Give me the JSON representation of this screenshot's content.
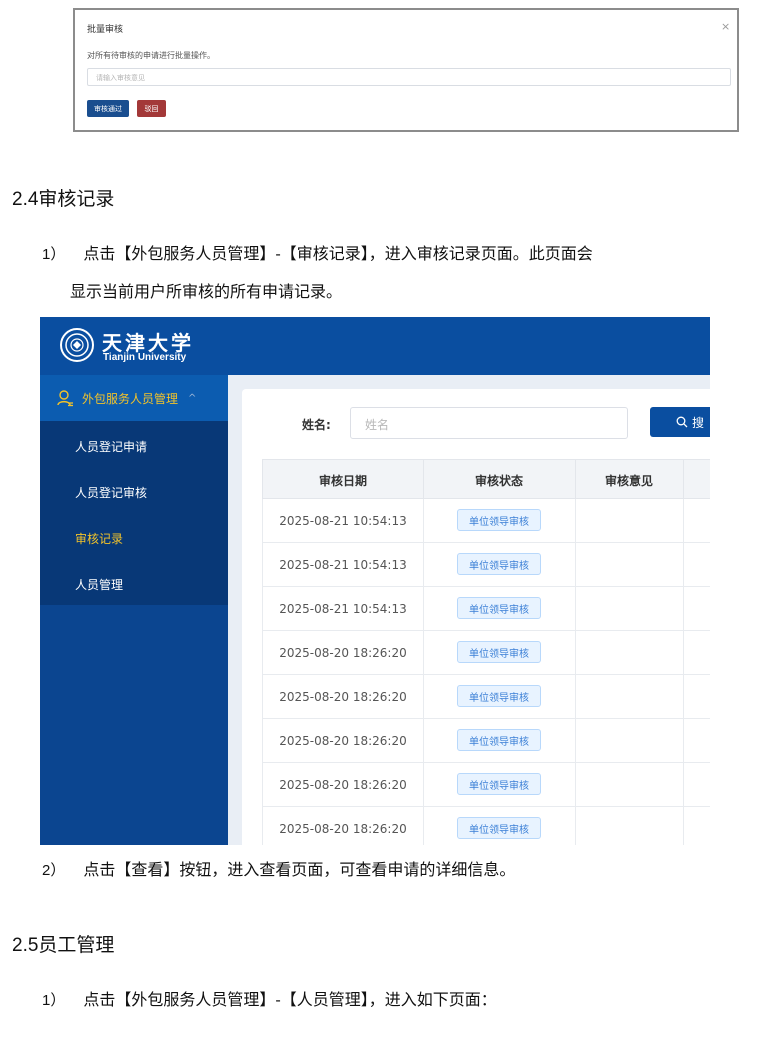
{
  "modal": {
    "title": "批量审核",
    "close": "×",
    "description": "对所有待审核的申请进行批量操作。",
    "input_placeholder": "请输入审核意见",
    "approve_label": "审核通过",
    "reject_label": "驳回"
  },
  "section_24": {
    "number": "2.4",
    "title": "审核记录",
    "step1_index": "1）",
    "step1_line1": "点击【外包服务人员管理】-【审核记录】，进入审核记录页面。此页面会",
    "step1_line2": "显示当前用户所审核的所有申请记录。",
    "step2_index": "2）",
    "step2_text": "点击【查看】按钮，进入查看页面，可查看申请的详细信息。"
  },
  "section_25": {
    "number": "2.5",
    "title": "员工管理",
    "step1_index": "1）",
    "step1_text": "点击【外包服务人员管理】-【人员管理】，进入如下页面："
  },
  "app": {
    "logo_cn": "天津大学",
    "logo_en": "Tianjin University",
    "sidebar": {
      "group_label": "外包服务人员管理",
      "group_chevron": "^",
      "items": [
        {
          "label": "人员登记申请",
          "active": false
        },
        {
          "label": "人员登记审核",
          "active": false
        },
        {
          "label": "审核记录",
          "active": true
        },
        {
          "label": "人员管理",
          "active": false
        }
      ]
    },
    "search": {
      "label": "姓名:",
      "placeholder": "姓名",
      "button_label": "搜"
    },
    "table": {
      "headers": [
        "审核日期",
        "审核状态",
        "审核意见"
      ],
      "rows": [
        {
          "date": "2025-08-21 10:54:13",
          "status": "单位领导审核"
        },
        {
          "date": "2025-08-21 10:54:13",
          "status": "单位领导审核"
        },
        {
          "date": "2025-08-21 10:54:13",
          "status": "单位领导审核"
        },
        {
          "date": "2025-08-20 18:26:20",
          "status": "单位领导审核"
        },
        {
          "date": "2025-08-20 18:26:20",
          "status": "单位领导审核"
        },
        {
          "date": "2025-08-20 18:26:20",
          "status": "单位领导审核"
        },
        {
          "date": "2025-08-20 18:26:20",
          "status": "单位领导审核"
        },
        {
          "date": "2025-08-20 18:26:20",
          "status": "单位领导审核"
        }
      ]
    },
    "colors": {
      "header_blue": "#0a4ea0",
      "sidebar_blue": "#0b4590",
      "active_yellow": "#f3c32a",
      "tag_blue": "#3a7fd6"
    }
  }
}
